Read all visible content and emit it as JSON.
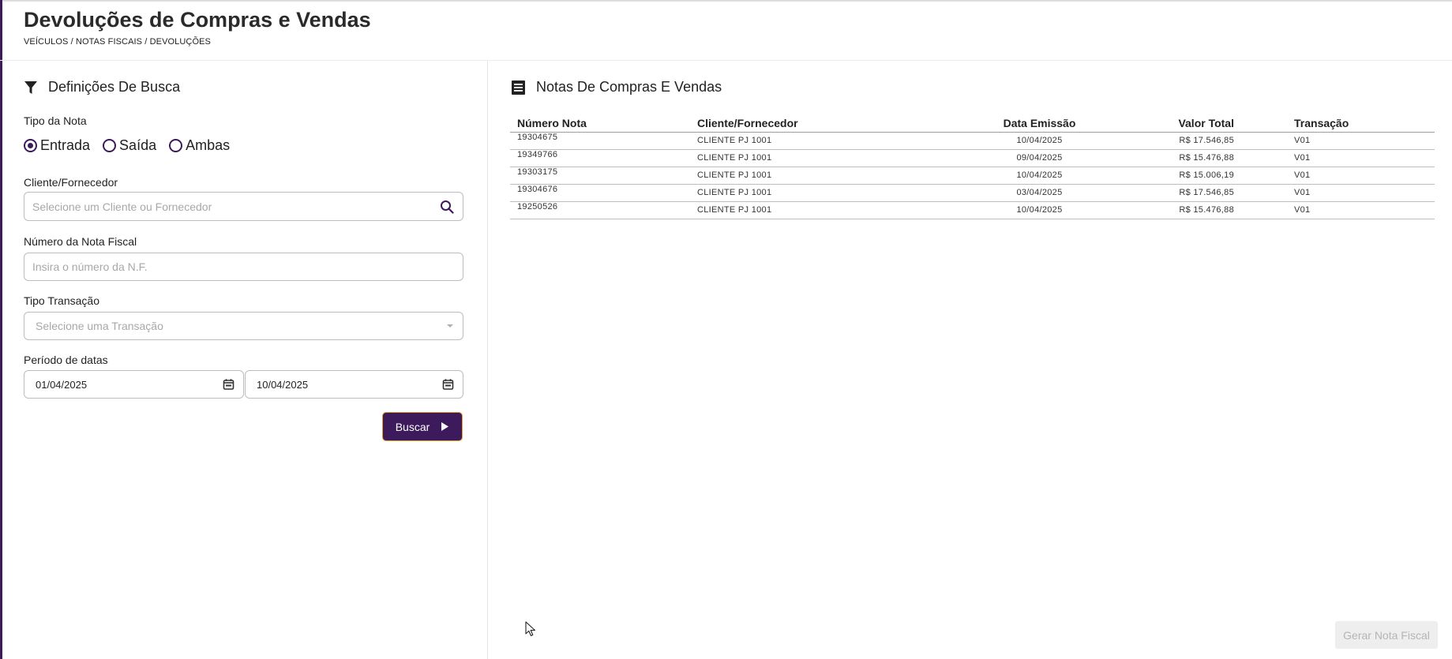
{
  "header": {
    "title": "Devoluções de Compras e Vendas",
    "breadcrumb": "VEÍCULOS / NOTAS FISCAIS / DEVOLUÇÕES"
  },
  "filters": {
    "section_title": "Definições De Busca",
    "section_icon": "filter-icon",
    "tipo_nota": {
      "label": "Tipo da Nota",
      "options": [
        "Entrada",
        "Saída",
        "Ambas"
      ],
      "selected": "Entrada"
    },
    "cliente": {
      "label": "Cliente/Fornecedor",
      "placeholder": "Selecione um Cliente ou Fornecedor",
      "icon": "search-icon"
    },
    "numero_nf": {
      "label": "Número da Nota Fiscal",
      "placeholder": "Insira o número da N.F."
    },
    "tipo_transacao": {
      "label": "Tipo Transação",
      "placeholder": "Selecione uma Transação"
    },
    "periodo": {
      "label": "Período de datas",
      "start": "01/04/2025",
      "end": "10/04/2025"
    },
    "search_button": "Buscar"
  },
  "notes": {
    "section_title": "Notas De Compras E Vendas",
    "section_icon": "receipt-icon",
    "columns": [
      "Número Nota",
      "Cliente/Fornecedor",
      "Data Emissão",
      "Valor Total",
      "Transação"
    ],
    "rows": [
      [
        "19304675",
        "CLIENTE PJ 1001",
        "10/04/2025",
        "R$ 17.546,85",
        "V01"
      ],
      [
        "19349766",
        "CLIENTE PJ 1001",
        "09/04/2025",
        "R$ 15.476,88",
        "V01"
      ],
      [
        "19303175",
        "CLIENTE PJ 1001",
        "10/04/2025",
        "R$ 15.006,19",
        "V01"
      ],
      [
        "19304676",
        "CLIENTE PJ 1001",
        "03/04/2025",
        "R$ 17.546,85",
        "V01"
      ],
      [
        "19250526",
        "CLIENTE PJ 1001",
        "10/04/2025",
        "R$ 15.476,88",
        "V01"
      ]
    ],
    "generate_button": "Gerar Nota Fiscal"
  },
  "colors": {
    "accent": "#3d1a5b",
    "button_border": "#e0a030",
    "disabled_bg": "#eeeeee"
  }
}
